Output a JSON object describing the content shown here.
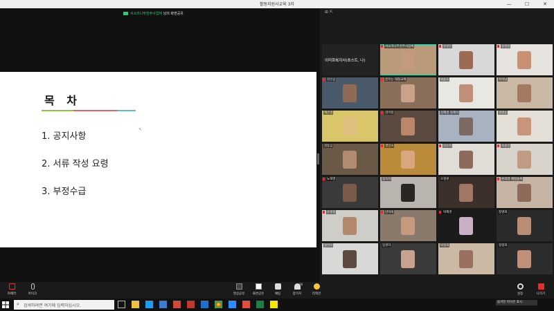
{
  "window": {
    "title": "활동지원사교육 3차",
    "min": "—",
    "max": "☐",
    "close": "✕"
  },
  "share": {
    "presenter": "서소미나무천주사업체",
    "suffix": "님의 화면공유"
  },
  "slide": {
    "title": "목 차",
    "underline_colors": [
      "#8fc63f",
      "#e06666",
      "#5bbcd6"
    ],
    "items": [
      "1. 공지사항",
      "2. 서류 작성 요령",
      "3. 부정수급"
    ]
  },
  "gallery": {
    "top_icons": "⊞  ⇱",
    "tiles": [
      {
        "name": "이미화복지사(호스트, 나)",
        "mic": false,
        "kind": "host"
      },
      {
        "name": "서소미나무천주사업체",
        "mic": true,
        "kind": "video",
        "bg": "#b99b7a",
        "face": "#c49a7c",
        "active": true
      },
      {
        "name": "정명진",
        "mic": true,
        "kind": "video",
        "bg": "#d8d8d8",
        "face": "#9c6b53"
      },
      {
        "name": "정명정",
        "mic": true,
        "kind": "video",
        "bg": "#e6e3de",
        "face": "#c89176"
      },
      {
        "name": "김선심",
        "mic": true,
        "kind": "video",
        "bg": "#4a5a6b",
        "face": "#8e6a57"
      },
      {
        "name": "꿈꾸는 대청교례",
        "mic": true,
        "kind": "video",
        "bg": "#8a6f5a",
        "face": "#caa28a"
      },
      {
        "name": "박윤도",
        "mic": false,
        "kind": "video",
        "bg": "#e9e7e2",
        "face": "#bf8f77"
      },
      {
        "name": "박석남",
        "mic": false,
        "kind": "video",
        "bg": "#c9b9a4",
        "face": "#a47a63"
      },
      {
        "name": "백은영",
        "mic": false,
        "kind": "video",
        "bg": "#d9c56a",
        "face": "#e0c080"
      },
      {
        "name": "김미정",
        "mic": true,
        "kind": "video",
        "bg": "#5a4a3f",
        "face": "#b8876c"
      },
      {
        "name": "김혜경 정재석",
        "mic": false,
        "kind": "video",
        "bg": "#a8b2c0",
        "face": "#7b6a62"
      },
      {
        "name": "권영순",
        "mic": false,
        "kind": "video",
        "bg": "#e4e0d8",
        "face": "#c9957a"
      },
      {
        "name": "김동심",
        "mic": false,
        "kind": "video",
        "bg": "#6b5948",
        "face": "#b28a6f"
      },
      {
        "name": "권민소",
        "mic": true,
        "kind": "video",
        "bg": "#b98b3a",
        "face": "#d7a77e"
      },
      {
        "name": "김유지",
        "mic": true,
        "kind": "video",
        "bg": "#e0ddd6",
        "face": "#8d6b5a"
      },
      {
        "name": "육송민",
        "mic": true,
        "kind": "video",
        "bg": "#d8d3cb",
        "face": "#c29a84"
      },
      {
        "name": "노희영",
        "mic": true,
        "kind": "video",
        "bg": "#3a3a3a",
        "face": "#7a5a4a"
      },
      {
        "name": "정옥자",
        "mic": false,
        "kind": "video",
        "bg": "#b9b4ad",
        "face": "#2a2624"
      },
      {
        "name": "오정원",
        "mic": false,
        "kind": "video",
        "bg": "#3d2f2a",
        "face": "#9f7764"
      },
      {
        "name": "온희영 재정블록",
        "mic": true,
        "kind": "video",
        "bg": "#c6b5a4",
        "face": "#8e6a5a"
      },
      {
        "name": "윤정정",
        "mic": true,
        "kind": "video",
        "bg": "#cfcdc8",
        "face": "#b3876c"
      },
      {
        "name": "안미숙",
        "mic": true,
        "kind": "video",
        "bg": "#8a7a6b",
        "face": "#c79a80"
      },
      {
        "name": "박혜경",
        "mic": true,
        "kind": "video",
        "bg": "#1b1b1b",
        "face": "#c8b0c6"
      },
      {
        "name": "정명희",
        "mic": false,
        "kind": "video",
        "bg": "#2b2b2b",
        "face": "#b98d75"
      },
      {
        "name": "정연희",
        "mic": false,
        "kind": "video",
        "bg": "#d8d8d6",
        "face": "#5d4a3f"
      },
      {
        "name": "임경자",
        "mic": false,
        "kind": "video",
        "bg": "#3b3b3b",
        "face": "#c6a390"
      },
      {
        "name": "박정희",
        "mic": false,
        "kind": "video",
        "bg": "#cbb9a6",
        "face": "#9a7160"
      },
      {
        "name": "정정희",
        "mic": false,
        "kind": "video",
        "bg": "#2d2d2d",
        "face": "#c28f78"
      }
    ]
  },
  "toolbar": {
    "camera": "카메라",
    "mic": "마이크",
    "share_stop": "영상공유",
    "screen_share": "화면공유",
    "chat": "채팅",
    "participants": "참가자",
    "participants_count": "28",
    "reactions": "리액션",
    "settings": "설정",
    "leave": "나가기"
  },
  "taskbar": {
    "search_placeholder": "검색하려면 여기에 입력하십시오.",
    "notification": "숨겨진 아이콘 표시"
  }
}
